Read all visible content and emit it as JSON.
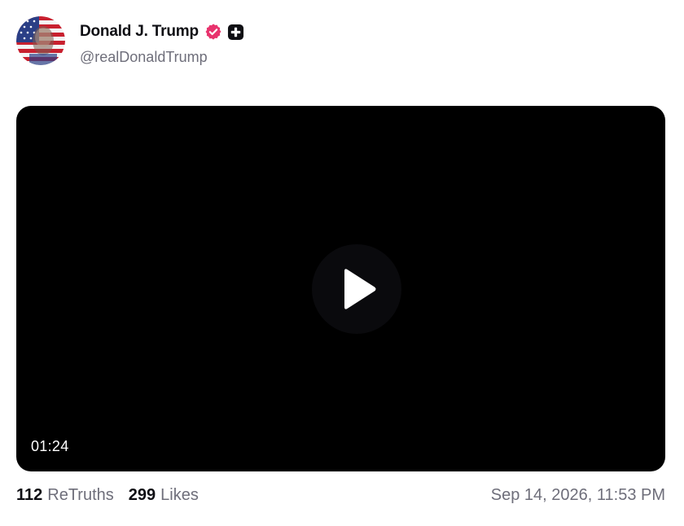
{
  "author": {
    "display_name": "Donald J. Trump",
    "handle": "@realDonaldTrump",
    "avatar_icon": "american-flag-portrait-avatar",
    "verified_icon": "verified-badge-icon",
    "verified_color": "#e8336d",
    "plus_icon": "plus-badge-icon"
  },
  "video": {
    "duration": "01:24",
    "play_icon": "play-icon"
  },
  "stats": {
    "retruths_count": "112",
    "retruths_label": "ReTruths",
    "likes_count": "299",
    "likes_label": "Likes"
  },
  "timestamp": "Sep 14, 2026, 11:53 PM"
}
